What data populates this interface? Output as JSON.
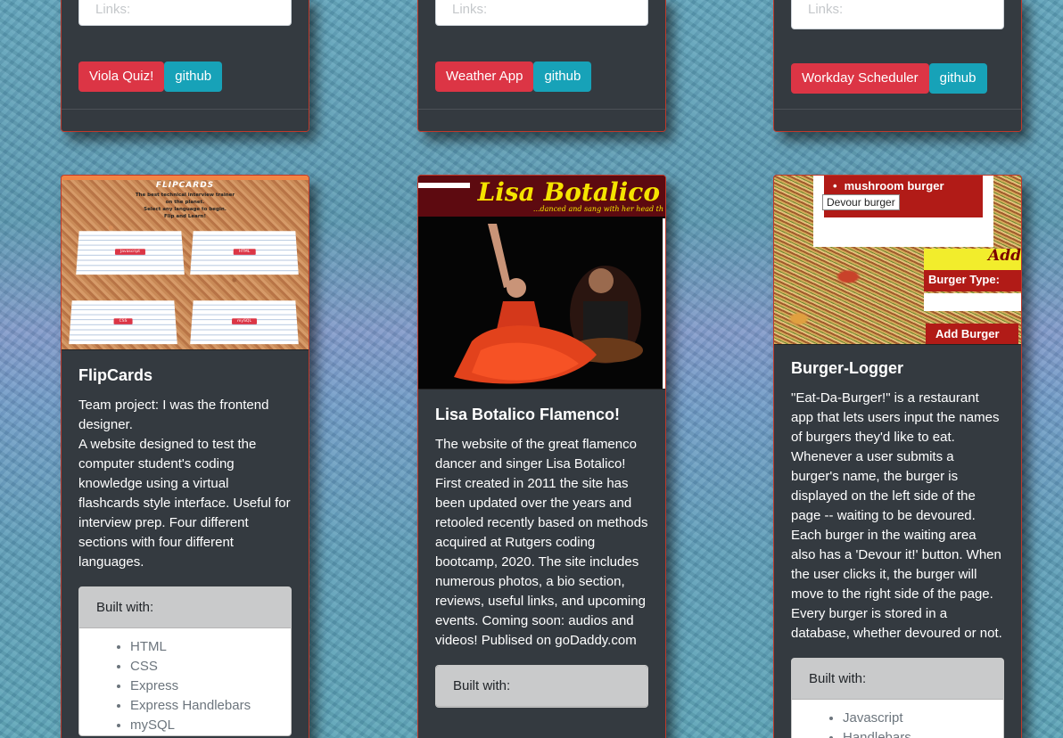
{
  "top_cards": [
    {
      "link_placeholder": "Links:",
      "project_button": "Viola Quiz!",
      "github_button": "github"
    },
    {
      "link_placeholder": "Links:",
      "project_button": "Weather App",
      "github_button": "github"
    },
    {
      "link_placeholder": "Links:",
      "project_button": "Workday Scheduler",
      "github_button": "github"
    }
  ],
  "cards": [
    {
      "title": "FlipCards",
      "description_lines": [
        "Team project: I was the frontend designer.",
        "A website designed to test the computer student's coding knowledge using a virtual flashcards style interface. Useful for interview prep. Four different sections with four different languages."
      ],
      "built_header": "Built with:",
      "built_items": [
        "HTML",
        "CSS",
        "Express",
        "Express Handlebars",
        "mySQL"
      ],
      "thumb": {
        "heading": "FLIPCARDS",
        "tagline_1": "The best technical interview trainer",
        "tagline_2": "on the planet.",
        "tagline_3": "Select any language to begin.",
        "tagline_4": "Flip and Learn!",
        "buttons": [
          "Javascript",
          "HTML",
          "CSS",
          "mySQL"
        ]
      }
    },
    {
      "title": "Lisa Botalico Flamenco!",
      "description": "The website of the great flamenco dancer and singer Lisa Botalico! First created in 2011 the site has been updated over the years and retooled recently based on methods acquired at Rutgers coding bootcamp, 2020. The site includes numerous photos, a bio section, reviews, useful links, and upcoming events. Coming soon: audios and videos! Publised on goDaddy.com",
      "built_header": "Built with:",
      "thumb": {
        "title": "Lisa Botalico",
        "subtitle": "...danced and sang with her head th"
      }
    },
    {
      "title": "Burger-Logger",
      "description": "\"Eat-Da-Burger!\" is a restaurant app that lets users input the names of burgers they'd like to eat. Whenever a user submits a burger's name, the burger is displayed on the left side of the page -- waiting to be devoured. Each burger in the waiting area also has a 'Devour it!' button. When the user clicks it, the burger will move to the right side of the page. Every burger is stored in a database, whether devoured or not.",
      "built_header": "Built with:",
      "built_items": [
        "Javascript",
        "Handlebars"
      ],
      "thumb": {
        "list_item": "mushroom burger",
        "devour_button": "Devour burger",
        "add_heading": "Add",
        "type_label": "Burger Type:",
        "add_button": "Add Burger"
      }
    }
  ]
}
